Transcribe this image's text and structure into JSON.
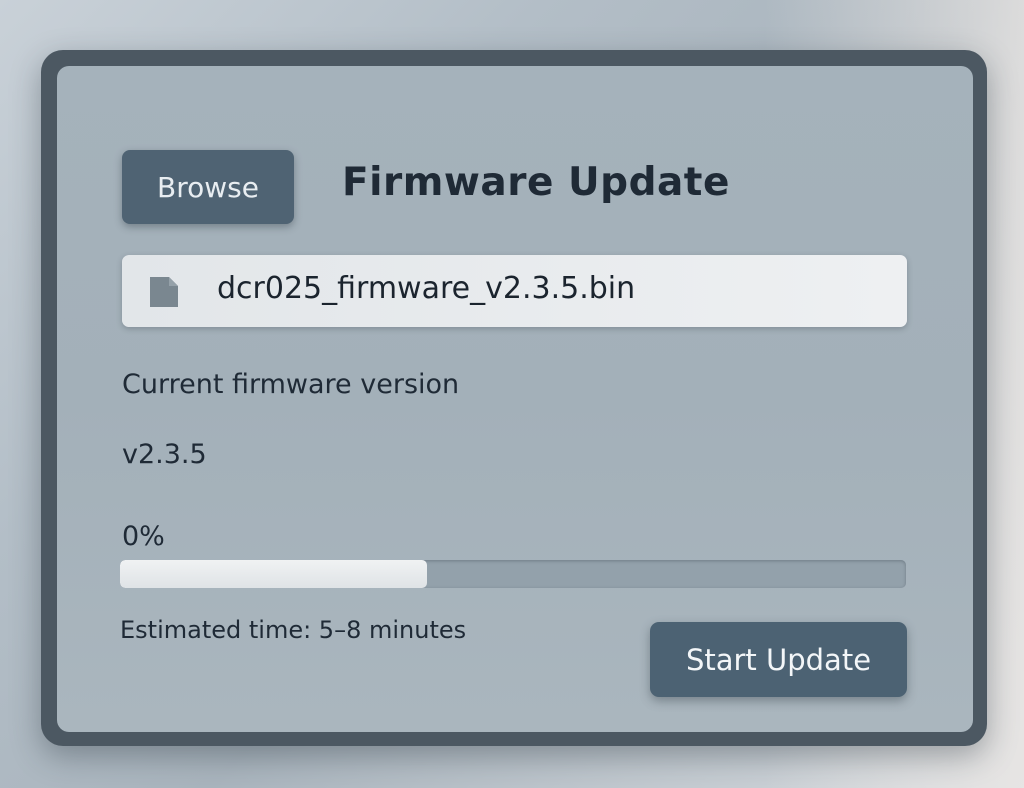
{
  "window": {
    "title": "Firmware Update"
  },
  "toolbar": {
    "browse_label": "Browse"
  },
  "file": {
    "icon": "file-icon",
    "name": "dcr025_firmware_v2.3.5.bin"
  },
  "firmware": {
    "current_label": "Current firmware version",
    "current_value": "v2.3.5"
  },
  "progress": {
    "label": "0%",
    "fill_fraction": 0.39
  },
  "estimate": {
    "text": "Estimated time: 5–8 minutes"
  },
  "actions": {
    "start_label": "Start Update"
  },
  "colors": {
    "accent": "#4f6373",
    "title_text": "#1f2a36",
    "progress_fill": "#eceff1",
    "progress_track": "#93a1ab"
  }
}
